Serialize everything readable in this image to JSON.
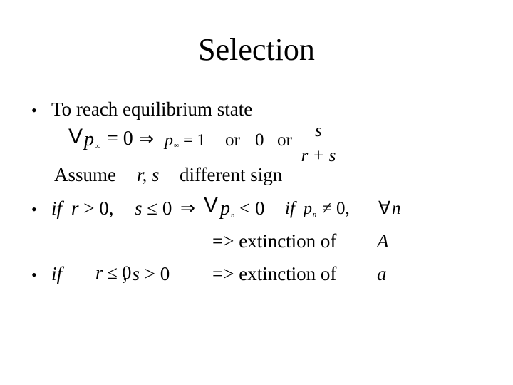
{
  "slide": {
    "title": "Selection",
    "bullets": [
      {
        "symbol": "•",
        "text": "To reach equilibrium state"
      },
      {
        "symbol": "•",
        "text": "if r > 0, s ≤ 0 ⇒ Δp_n < 0 if p_n ≠ 0, ∀n"
      },
      {
        "symbol": "•",
        "text": "if r ≤ 0, s > 0 => extinction of a"
      }
    ],
    "equation1": {
      "delta": "V",
      "p": "p",
      "inf_sub": "∞",
      "eq0": "= 0",
      "implies": "⇒",
      "eq1": "= 1",
      "or1": "or",
      "zero": "0",
      "or2": "or",
      "frac_num": "s",
      "frac_den": "r + s"
    },
    "assume": {
      "prefix": "Assume",
      "vars": "r, s",
      "suffix": "different sign"
    },
    "case1": {
      "if": "if",
      "cond_r": "r > 0,",
      "cond_s": "s ≤ 0",
      "implies": "⇒",
      "delta": "V",
      "p": "p",
      "n_sub": "n",
      "lt0": "< 0",
      "if2": "if",
      "neq0": "≠ 0,",
      "forall": "∀",
      "n": "n",
      "result": "=> extinction of",
      "result_var": "A"
    },
    "case2": {
      "if": "if",
      "cond_r": "r ≤ 0,",
      "cond_s": "s > 0",
      "result": "=> extinction of",
      "result_var": "a"
    }
  }
}
